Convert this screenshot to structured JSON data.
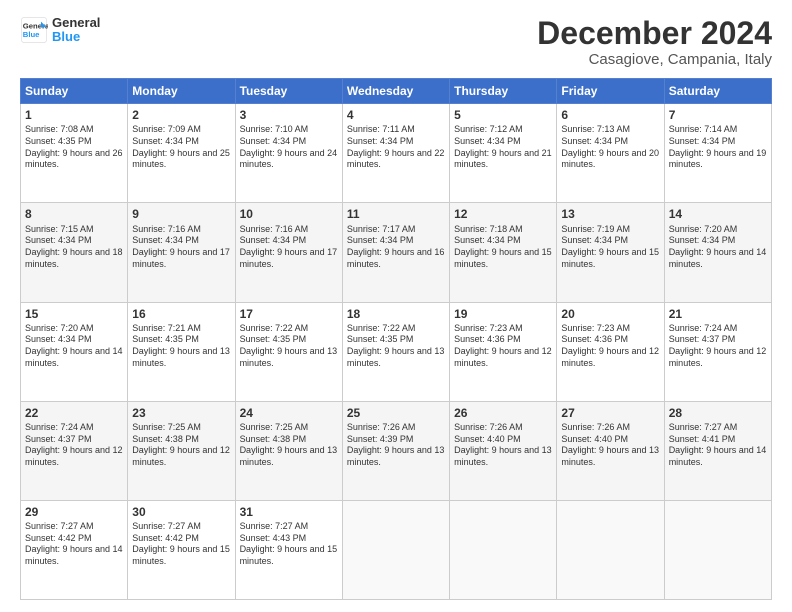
{
  "logo": {
    "line1": "General",
    "line2": "Blue"
  },
  "title": "December 2024",
  "subtitle": "Casagiove, Campania, Italy",
  "headers": [
    "Sunday",
    "Monday",
    "Tuesday",
    "Wednesday",
    "Thursday",
    "Friday",
    "Saturday"
  ],
  "weeks": [
    [
      {
        "day": "1",
        "sunrise": "7:08 AM",
        "sunset": "4:35 PM",
        "daylight": "9 hours and 26 minutes."
      },
      {
        "day": "2",
        "sunrise": "7:09 AM",
        "sunset": "4:34 PM",
        "daylight": "9 hours and 25 minutes."
      },
      {
        "day": "3",
        "sunrise": "7:10 AM",
        "sunset": "4:34 PM",
        "daylight": "9 hours and 24 minutes."
      },
      {
        "day": "4",
        "sunrise": "7:11 AM",
        "sunset": "4:34 PM",
        "daylight": "9 hours and 22 minutes."
      },
      {
        "day": "5",
        "sunrise": "7:12 AM",
        "sunset": "4:34 PM",
        "daylight": "9 hours and 21 minutes."
      },
      {
        "day": "6",
        "sunrise": "7:13 AM",
        "sunset": "4:34 PM",
        "daylight": "9 hours and 20 minutes."
      },
      {
        "day": "7",
        "sunrise": "7:14 AM",
        "sunset": "4:34 PM",
        "daylight": "9 hours and 19 minutes."
      }
    ],
    [
      {
        "day": "8",
        "sunrise": "7:15 AM",
        "sunset": "4:34 PM",
        "daylight": "9 hours and 18 minutes."
      },
      {
        "day": "9",
        "sunrise": "7:16 AM",
        "sunset": "4:34 PM",
        "daylight": "9 hours and 17 minutes."
      },
      {
        "day": "10",
        "sunrise": "7:16 AM",
        "sunset": "4:34 PM",
        "daylight": "9 hours and 17 minutes."
      },
      {
        "day": "11",
        "sunrise": "7:17 AM",
        "sunset": "4:34 PM",
        "daylight": "9 hours and 16 minutes."
      },
      {
        "day": "12",
        "sunrise": "7:18 AM",
        "sunset": "4:34 PM",
        "daylight": "9 hours and 15 minutes."
      },
      {
        "day": "13",
        "sunrise": "7:19 AM",
        "sunset": "4:34 PM",
        "daylight": "9 hours and 15 minutes."
      },
      {
        "day": "14",
        "sunrise": "7:20 AM",
        "sunset": "4:34 PM",
        "daylight": "9 hours and 14 minutes."
      }
    ],
    [
      {
        "day": "15",
        "sunrise": "7:20 AM",
        "sunset": "4:34 PM",
        "daylight": "9 hours and 14 minutes."
      },
      {
        "day": "16",
        "sunrise": "7:21 AM",
        "sunset": "4:35 PM",
        "daylight": "9 hours and 13 minutes."
      },
      {
        "day": "17",
        "sunrise": "7:22 AM",
        "sunset": "4:35 PM",
        "daylight": "9 hours and 13 minutes."
      },
      {
        "day": "18",
        "sunrise": "7:22 AM",
        "sunset": "4:35 PM",
        "daylight": "9 hours and 13 minutes."
      },
      {
        "day": "19",
        "sunrise": "7:23 AM",
        "sunset": "4:36 PM",
        "daylight": "9 hours and 12 minutes."
      },
      {
        "day": "20",
        "sunrise": "7:23 AM",
        "sunset": "4:36 PM",
        "daylight": "9 hours and 12 minutes."
      },
      {
        "day": "21",
        "sunrise": "7:24 AM",
        "sunset": "4:37 PM",
        "daylight": "9 hours and 12 minutes."
      }
    ],
    [
      {
        "day": "22",
        "sunrise": "7:24 AM",
        "sunset": "4:37 PM",
        "daylight": "9 hours and 12 minutes."
      },
      {
        "day": "23",
        "sunrise": "7:25 AM",
        "sunset": "4:38 PM",
        "daylight": "9 hours and 12 minutes."
      },
      {
        "day": "24",
        "sunrise": "7:25 AM",
        "sunset": "4:38 PM",
        "daylight": "9 hours and 13 minutes."
      },
      {
        "day": "25",
        "sunrise": "7:26 AM",
        "sunset": "4:39 PM",
        "daylight": "9 hours and 13 minutes."
      },
      {
        "day": "26",
        "sunrise": "7:26 AM",
        "sunset": "4:40 PM",
        "daylight": "9 hours and 13 minutes."
      },
      {
        "day": "27",
        "sunrise": "7:26 AM",
        "sunset": "4:40 PM",
        "daylight": "9 hours and 13 minutes."
      },
      {
        "day": "28",
        "sunrise": "7:27 AM",
        "sunset": "4:41 PM",
        "daylight": "9 hours and 14 minutes."
      }
    ],
    [
      {
        "day": "29",
        "sunrise": "7:27 AM",
        "sunset": "4:42 PM",
        "daylight": "9 hours and 14 minutes."
      },
      {
        "day": "30",
        "sunrise": "7:27 AM",
        "sunset": "4:42 PM",
        "daylight": "9 hours and 15 minutes."
      },
      {
        "day": "31",
        "sunrise": "7:27 AM",
        "sunset": "4:43 PM",
        "daylight": "9 hours and 15 minutes."
      },
      null,
      null,
      null,
      null
    ]
  ]
}
